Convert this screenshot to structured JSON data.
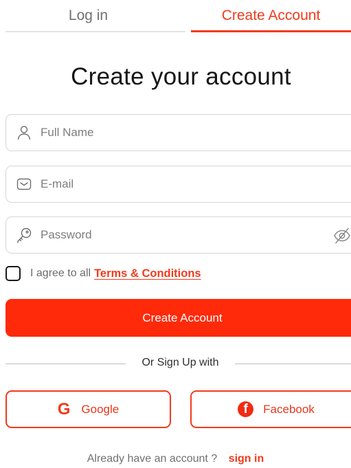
{
  "tabs": {
    "login": "Log in",
    "create": "Create Account"
  },
  "heading": "Create your account",
  "fields": {
    "full_name": {
      "placeholder": "Full Name",
      "value": ""
    },
    "email": {
      "placeholder": "E-mail",
      "value": ""
    },
    "password": {
      "placeholder": "Password",
      "value": ""
    }
  },
  "terms": {
    "prefix": "I agree to all",
    "link": "Terms & Conditions",
    "checked": false
  },
  "primary_button": "Create Account",
  "divider": "Or Sign Up with",
  "social": {
    "google": "Google",
    "google_glyph": "G",
    "facebook": "Facebook",
    "facebook_glyph": "f"
  },
  "footer": {
    "text": "Already have an account ?",
    "link": "sign in"
  },
  "colors": {
    "accent": "#f23a1c",
    "button": "#ff2a0a",
    "border": "#d6d6d6"
  },
  "icons": [
    "user-icon",
    "mail-icon",
    "key-icon",
    "eye-off-icon",
    "google-icon",
    "facebook-icon"
  ]
}
